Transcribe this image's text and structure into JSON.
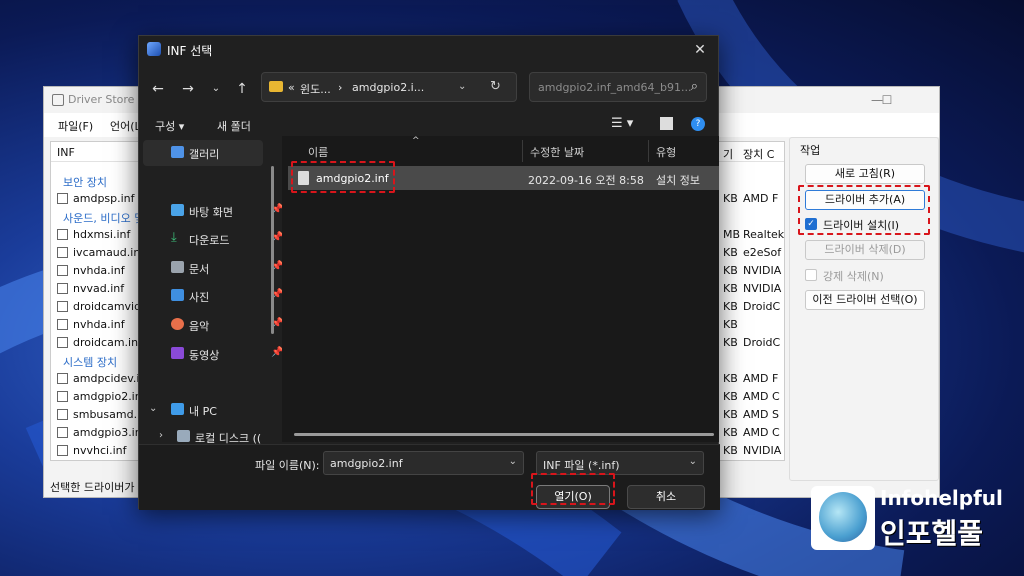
{
  "colors": {
    "accent_red": "#d8151b",
    "checkbox_blue": "#1f6fd1",
    "dialog_bg": "#202020"
  },
  "dse": {
    "title": "Driver Store Ex",
    "menu": [
      "파일(F)",
      "언어(L"
    ],
    "list_header": "INF",
    "groups": {
      "security": "보안 장치",
      "sound": "사운드, 비디오 및",
      "system": "시스템 장치"
    },
    "rows": [
      {
        "name": "amdpsp.inf",
        "vendor": "AMD F"
      },
      {
        "name": "hdxmsi.inf",
        "vendor": "Realtek"
      },
      {
        "name": "ivcamaud.inf",
        "vendor": "e2eSof"
      },
      {
        "name": "nvhda.inf",
        "vendor": "NVIDIA"
      },
      {
        "name": "nvvad.inf",
        "vendor": "NVIDIA"
      },
      {
        "name": "droidcamvide",
        "vendor": "DroidC"
      },
      {
        "name": "nvhda.inf",
        "vendor": ""
      },
      {
        "name": "droidcam.inf",
        "vendor": "DroidC"
      },
      {
        "name": "amdpcidev.inf",
        "vendor": "AMD F"
      },
      {
        "name": "amdgpio2.inf",
        "vendor": "AMD C"
      },
      {
        "name": "smbusamd.inf",
        "vendor": "AMD S"
      },
      {
        "name": "amdgpio3.inf",
        "vendor": "AMD C"
      },
      {
        "name": "nvvhci.inf",
        "vendor": "NVIDIA"
      }
    ],
    "sizes": [
      "KB",
      "MB",
      "KB",
      "KB",
      "KB",
      "KB",
      "KB",
      "KB",
      "KB",
      "KB",
      "KB",
      "KB",
      "KB"
    ],
    "col_headers": {
      "version": "기",
      "device": "장치 C"
    },
    "status": "선택한 드라이버가",
    "panel_title": "작업",
    "btn_refresh": "새로 고침(R)",
    "btn_add": "드라이버 추가(A)",
    "chk_install": "드라이버 설치(I)",
    "btn_delete": "드라이버 삭제(D)",
    "chk_force": "강제 삭제(N)",
    "btn_old": "이전 드라이버 선택(O)"
  },
  "dialog": {
    "title": "INF 선택",
    "address": {
      "prefix": "«",
      "crumb1": "윈도...",
      "sep": "›",
      "crumb2": "amdgpio2.i..."
    },
    "search_placeholder": "amdgpio2.inf_amd64_b91...",
    "toolbar": {
      "organize": "구성 ▾",
      "new_folder": "새 폴더"
    },
    "nav": {
      "gallery": "갤러리",
      "desktop": "바탕 화면",
      "downloads": "다운로드",
      "documents": "문서",
      "pictures": "사진",
      "music": "음악",
      "videos": "동영상",
      "this_pc": "내 PC",
      "local_disk": "로컬 디스크 (("
    },
    "columns": {
      "name": "이름",
      "date": "수정한 날짜",
      "type": "유형"
    },
    "file": {
      "name": "amdgpio2.inf",
      "date": "2022-09-16 오전 8:58",
      "type": "설치 정보"
    },
    "filename_label": "파일 이름(N):",
    "filename_value": "amdgpio2.inf",
    "filetype_value": "INF 파일  (*.inf)",
    "open_label": "열기(O)",
    "cancel_label": "취소"
  },
  "brand": {
    "en": "Infohelpful",
    "ko": "인포헬풀"
  }
}
